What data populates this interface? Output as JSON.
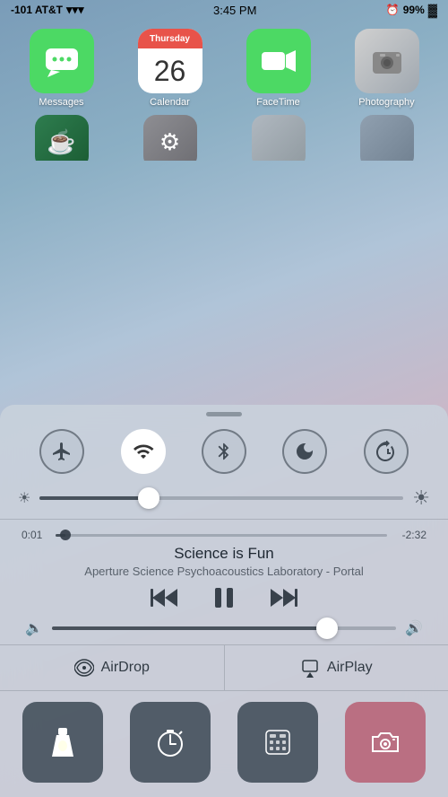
{
  "statusBar": {
    "carrier": "-101 AT&T",
    "wifi": "wifi",
    "time": "3:45 PM",
    "battery_icon": "alarm",
    "battery": "99%"
  },
  "apps": {
    "row1": [
      {
        "id": "messages",
        "label": "Messages",
        "icon": "messages"
      },
      {
        "id": "calendar",
        "label": "Calendar",
        "icon": "calendar",
        "day": "Thursday",
        "date": "26"
      },
      {
        "id": "facetime",
        "label": "FaceTime",
        "icon": "facetime"
      },
      {
        "id": "photography",
        "label": "Photography",
        "icon": "photography"
      }
    ]
  },
  "controlCenter": {
    "toggles": [
      {
        "id": "airplane",
        "label": "Airplane Mode",
        "icon": "✈",
        "active": false
      },
      {
        "id": "wifi",
        "label": "WiFi",
        "icon": "wifi",
        "active": true
      },
      {
        "id": "bluetooth",
        "label": "Bluetooth",
        "icon": "bluetooth",
        "active": false
      },
      {
        "id": "donotdisturb",
        "label": "Do Not Disturb",
        "icon": "moon",
        "active": false
      },
      {
        "id": "rotation",
        "label": "Rotation Lock",
        "icon": "rotation",
        "active": false
      }
    ],
    "brightness": {
      "value": 30,
      "min_icon": "☀",
      "max_icon": "☀"
    },
    "music": {
      "current_time": "0:01",
      "total_time": "-2:32",
      "progress": 3,
      "title": "Science is Fun",
      "artist": "Aperture Science Psychoacoustics Laboratory - Portal"
    },
    "volume": {
      "value": 80
    },
    "airdrop_label": "AirDrop",
    "airplay_label": "AirPlay",
    "quickActions": [
      {
        "id": "flashlight",
        "icon": "flashlight",
        "label": "Flashlight"
      },
      {
        "id": "timer",
        "icon": "timer",
        "label": "Timer"
      },
      {
        "id": "calculator",
        "icon": "calculator",
        "label": "Calculator"
      },
      {
        "id": "camera",
        "icon": "camera",
        "label": "Camera"
      }
    ]
  }
}
